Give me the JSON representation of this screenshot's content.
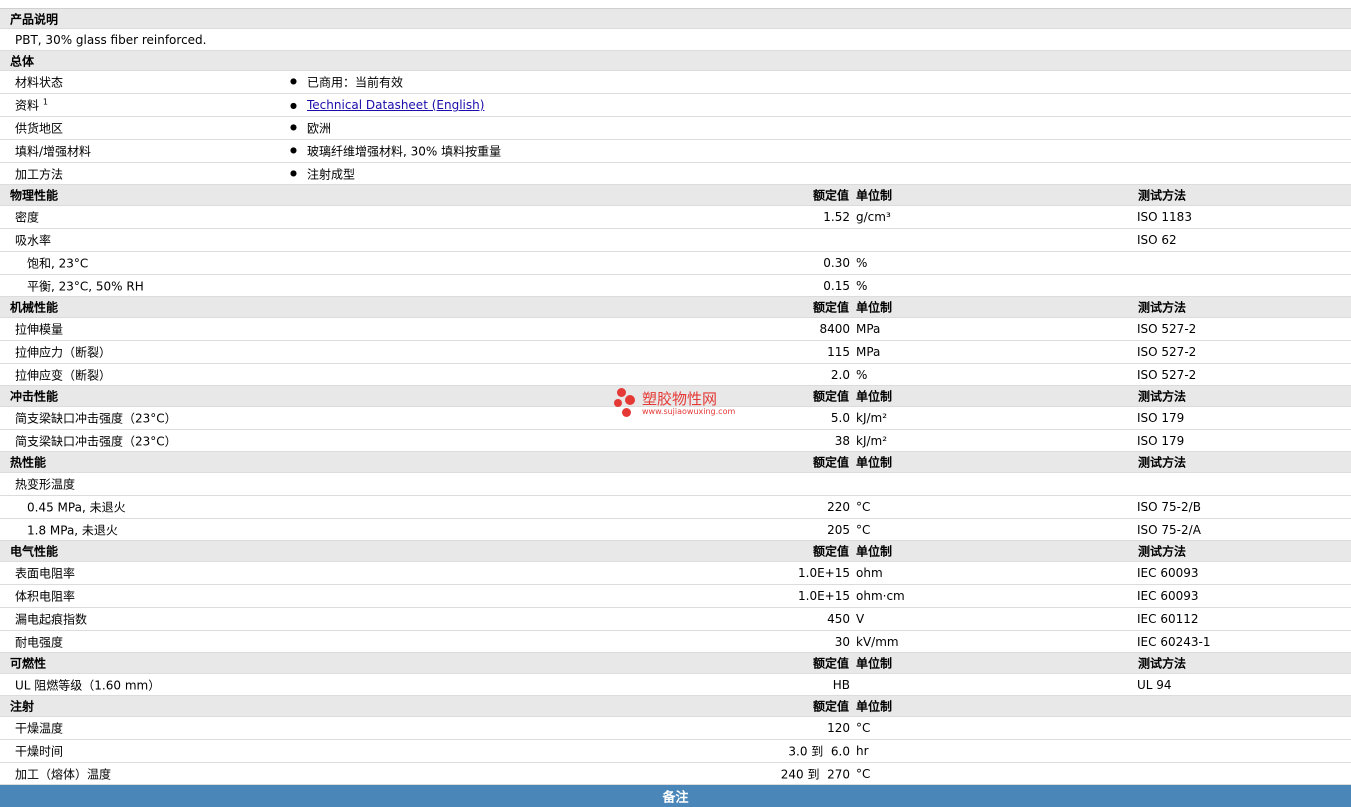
{
  "sections": {
    "desc": {
      "title": "产品说明",
      "text": "PBT, 30% glass fiber reinforced."
    },
    "general": {
      "title": "总体",
      "rows": [
        {
          "label": "材料状态",
          "value": "已商用：当前有效"
        },
        {
          "label": "资料",
          "sup": "1",
          "value": "Technical Datasheet (English)"
        },
        {
          "label": "供货地区",
          "value": "欧洲"
        },
        {
          "label": "填料/增强材料",
          "value": "玻璃纤维增强材料, 30% 填料按重量"
        },
        {
          "label": "加工方法",
          "value": "注射成型"
        }
      ]
    },
    "col_headers": {
      "value": "额定值",
      "unit": "单位制",
      "test": "测试方法"
    },
    "physical": {
      "title": "物理性能",
      "rows": [
        {
          "label": "密度",
          "value": "1.52",
          "unit": "g/cm³",
          "test": "ISO 1183"
        },
        {
          "label": "吸水率",
          "value": "",
          "unit": "",
          "test": "ISO 62"
        },
        {
          "label": "饱和, 23°C",
          "value": "0.30",
          "unit": "%",
          "test": ""
        },
        {
          "label": "平衡, 23°C, 50% RH",
          "value": "0.15",
          "unit": "%",
          "test": ""
        }
      ]
    },
    "mechanical": {
      "title": "机械性能",
      "rows": [
        {
          "label": "拉伸模量",
          "value": "8400",
          "unit": "MPa",
          "test": "ISO 527-2"
        },
        {
          "label": "拉伸应力（断裂）",
          "value": "115",
          "unit": "MPa",
          "test": "ISO 527-2"
        },
        {
          "label": "拉伸应变（断裂）",
          "value": "2.0",
          "unit": "%",
          "test": "ISO 527-2"
        }
      ]
    },
    "impact": {
      "title": "冲击性能",
      "rows": [
        {
          "label": "简支梁缺口冲击强度（23°C）",
          "value": "5.0",
          "unit": "kJ/m²",
          "test": "ISO 179"
        },
        {
          "label": "简支梁缺口冲击强度（23°C）",
          "value": "38",
          "unit": "kJ/m²",
          "test": "ISO 179"
        }
      ]
    },
    "thermal": {
      "title": "热性能",
      "rows": [
        {
          "label": "热变形温度",
          "value": "",
          "unit": "",
          "test": ""
        },
        {
          "label": "0.45 MPa, 未退火",
          "value": "220",
          "unit": "°C",
          "test": "ISO 75-2/B"
        },
        {
          "label": "1.8 MPa, 未退火",
          "value": "205",
          "unit": "°C",
          "test": "ISO 75-2/A"
        }
      ]
    },
    "electrical": {
      "title": "电气性能",
      "rows": [
        {
          "label": "表面电阻率",
          "value": "1.0E+15",
          "unit": "ohm",
          "test": "IEC 60093"
        },
        {
          "label": "体积电阻率",
          "value": "1.0E+15",
          "unit": "ohm·cm",
          "test": "IEC 60093"
        },
        {
          "label": "漏电起痕指数",
          "value": "450",
          "unit": "V",
          "test": "IEC 60112"
        },
        {
          "label": "耐电强度",
          "value": "30",
          "unit": "kV/mm",
          "test": "IEC 60243-1"
        }
      ]
    },
    "flammability": {
      "title": "可燃性",
      "rows": [
        {
          "label": "UL 阻燃等级（1.60 mm）",
          "value": "HB",
          "unit": "",
          "test": "UL 94"
        }
      ]
    },
    "injection": {
      "title": "注射",
      "rows": [
        {
          "label": "干燥温度",
          "value": "120",
          "unit": "°C",
          "test": ""
        },
        {
          "label": "干燥时间",
          "value": "3.0 到  6.0",
          "unit": "hr",
          "test": ""
        },
        {
          "label": "加工（熔体）温度",
          "value": "240 到  270",
          "unit": "°C",
          "test": ""
        }
      ]
    }
  },
  "watermark": {
    "title": "塑胶物性网",
    "url": "www.sujiaowuxing.com"
  },
  "footer": {
    "label": "备注"
  },
  "colors": {
    "header_bg": "#e8e8e8",
    "footer_bg": "#4a86b8",
    "link": "#1a0dab",
    "watermark": "#e53935"
  }
}
